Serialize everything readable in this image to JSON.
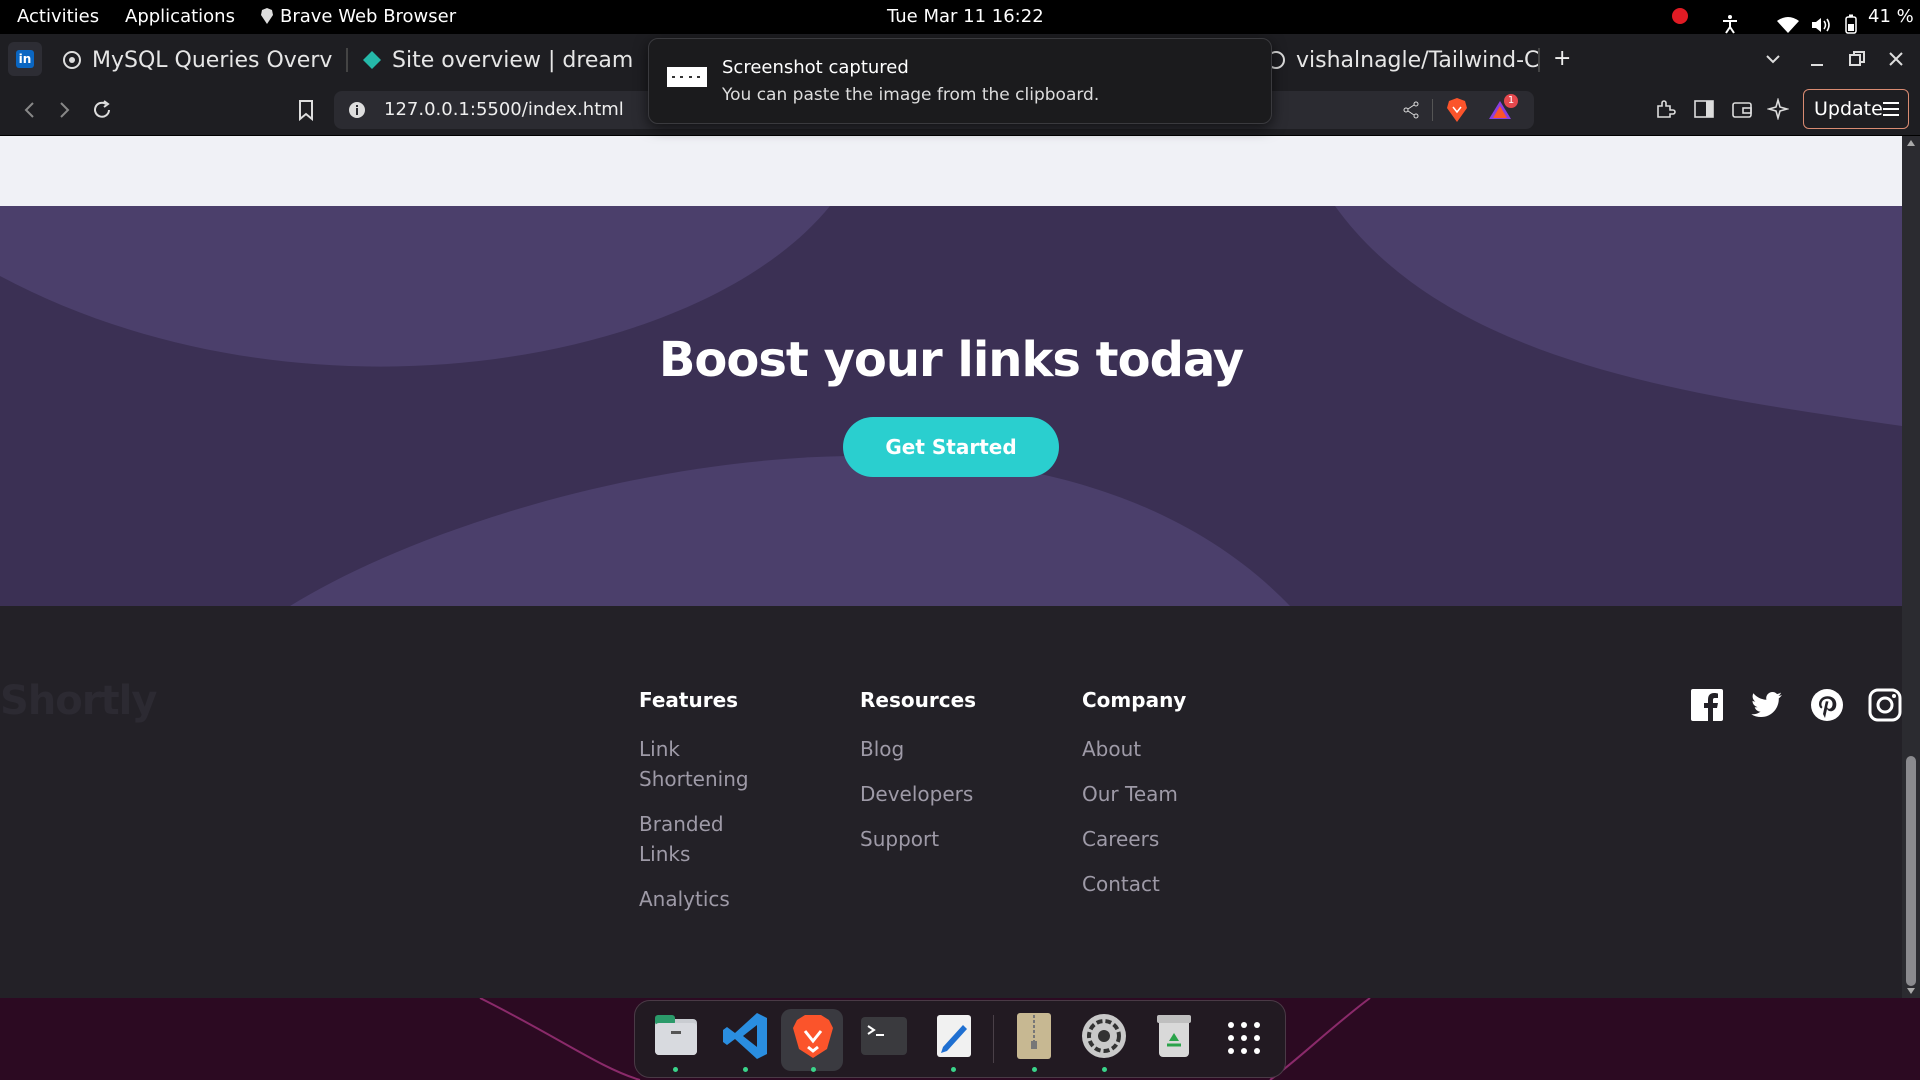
{
  "system_bar": {
    "activities": "Activities",
    "applications": "Applications",
    "app_name": "Brave Web Browser",
    "datetime": "Tue Mar 11  16:22",
    "battery": "41 %"
  },
  "browser": {
    "tabs": [
      {
        "label": "MySQL Queries Overv"
      },
      {
        "label": "Site overview | dreamy"
      },
      {
        "label": "vishalnagle/Tailwind-C"
      }
    ],
    "url": "127.0.0.1:5500/index.html",
    "update_label": "Update",
    "shield_badge": "1"
  },
  "notification": {
    "title": "Screenshot captured",
    "body": "You can paste the image from the clipboard."
  },
  "page": {
    "boost": {
      "heading": "Boost your links today",
      "cta": "Get Started"
    },
    "footer": {
      "logo": "Shortly",
      "columns": [
        {
          "title": "Features",
          "links": [
            "Link Shortening",
            "Branded Links",
            "Analytics"
          ]
        },
        {
          "title": "Resources",
          "links": [
            "Blog",
            "Developers",
            "Support"
          ]
        },
        {
          "title": "Company",
          "links": [
            "About",
            "Our Team",
            "Careers",
            "Contact"
          ]
        }
      ],
      "social": [
        "facebook-icon",
        "twitter-icon",
        "pinterest-icon",
        "instagram-icon"
      ]
    }
  },
  "colors": {
    "cta": "#2acfcf",
    "boost_bg": "#3b3054",
    "footer_bg": "#232127",
    "brave_orange": "#fb542b"
  },
  "dock": {
    "apps": [
      "files-icon",
      "vscode-icon",
      "brave-icon",
      "terminal-icon",
      "text-editor-icon",
      "archive-manager-icon",
      "settings-icon",
      "trash-icon",
      "show-apps-icon"
    ]
  }
}
